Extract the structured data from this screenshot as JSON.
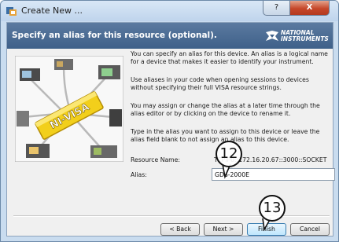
{
  "window": {
    "title": "Create New ...",
    "help_label": "?",
    "close_label": "X"
  },
  "banner": {
    "title": "Specify an alias for this resource (optional).",
    "logo_line1": "NATIONAL",
    "logo_line2": "INSTRUMENTS"
  },
  "illustration": {
    "label": "NI-VISA"
  },
  "paragraphs": [
    "You can specify an alias for this device. An alias is a logical name for a device that makes it easier to identify your instrument.",
    "Use aliases in your code when opening sessions to devices without specifying their full VISA resource strings.",
    "You may assign or change the alias at a later time through the alias editor or by clicking on the device to rename it.",
    "Type in the alias you want to assign to this device or leave the alias field blank to not assign an alias to this device."
  ],
  "form": {
    "resource_label": "Resource Name:",
    "resource_value": "TCPIP0::172.16.20.67::3000::SOCKET",
    "alias_label": "Alias:",
    "alias_value": "GDS-2000E"
  },
  "buttons": {
    "back": "< Back",
    "next": "Next >",
    "finish": "Finish",
    "cancel": "Cancel"
  },
  "callouts": [
    "12",
    "13"
  ],
  "colors": {
    "banner": "#4a6b93",
    "client": "#f0f0f0",
    "frame": "#c9dcef",
    "close": "#c6472a"
  }
}
